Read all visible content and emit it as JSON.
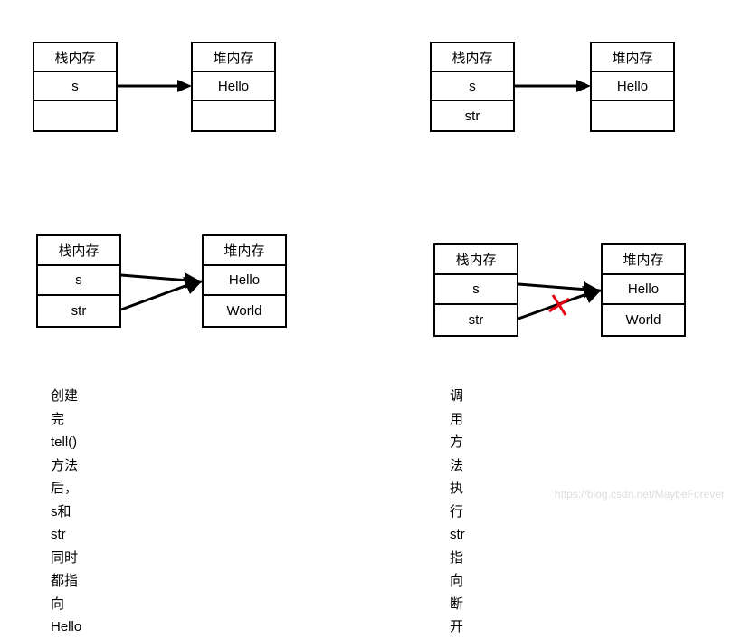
{
  "labels": {
    "stack": "栈内存",
    "heap": "堆内存",
    "s": "s",
    "str": "str",
    "hello": "Hello",
    "world": "World"
  },
  "captions": {
    "bottom_left_line1": "创建完tell()方法后，s和str",
    "bottom_left_line2": "同时都指向Hello",
    "bottom_right_line1": "调用方法执行",
    "bottom_right_line2": "str指向断开"
  },
  "watermark": "https://blog.csdn.net/MaybeForever"
}
